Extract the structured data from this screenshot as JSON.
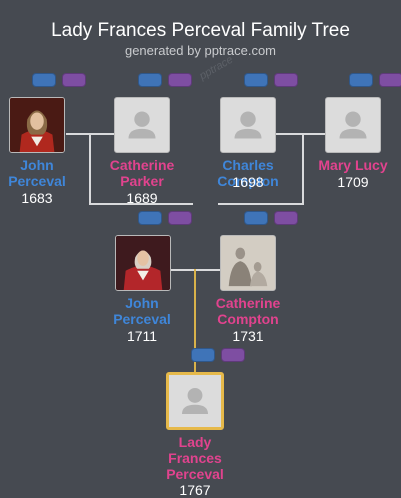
{
  "title": "Lady Frances Perceval Family Tree",
  "subtitle": "generated by pptrace.com",
  "watermark": "pptrace",
  "colors": {
    "background": "#464a51",
    "male": "#3f86d9",
    "female": "#e1438e",
    "highlight": "#e6b94a",
    "father_button": "#3f74b8",
    "mother_button": "#7e4ea2"
  },
  "people": {
    "gf1": {
      "first": "John",
      "last": "Perceval",
      "year": "1683",
      "sex": "male",
      "photo": "portrait"
    },
    "gm1": {
      "first": "Catherine",
      "last": "Parker",
      "year": "1689",
      "sex": "female",
      "photo": "silhouette"
    },
    "gf2": {
      "first": "Charles",
      "last": "Compton",
      "year": "1698",
      "sex": "male",
      "photo": "silhouette"
    },
    "gm2": {
      "first": "Mary Lucy",
      "last": "",
      "year": "1709",
      "sex": "female",
      "photo": "silhouette"
    },
    "father": {
      "first": "John",
      "last": "Perceval",
      "year": "1711",
      "sex": "male",
      "photo": "portrait"
    },
    "mother": {
      "first": "Catherine",
      "last": "Compton",
      "year": "1731",
      "sex": "female",
      "photo": "engraving"
    },
    "subject": {
      "first": "Lady",
      "middle": "Frances",
      "last": "Perceval",
      "year": "1767",
      "sex": "female",
      "photo": "silhouette"
    }
  }
}
